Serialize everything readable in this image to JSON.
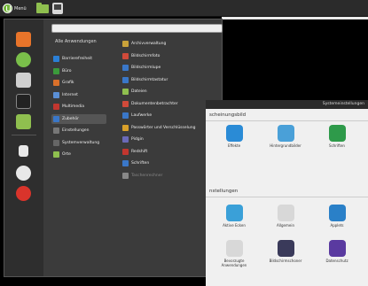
{
  "panel": {
    "menu_label": "Menü"
  },
  "menu": {
    "search_placeholder": "",
    "all_apps": "Alle Anwendungen",
    "categories": [
      {
        "label": "Barrierefreiheit",
        "color": "#2b7fd6",
        "icon": "accessibility-icon"
      },
      {
        "label": "Büro",
        "color": "#3b9a3b",
        "icon": "office-icon"
      },
      {
        "label": "Grafik",
        "color": "#d9702a",
        "icon": "graphics-icon"
      },
      {
        "label": "Internet",
        "color": "#5a8fd6",
        "icon": "internet-icon"
      },
      {
        "label": "Multimedia",
        "color": "#c2362f",
        "icon": "multimedia-icon"
      },
      {
        "label": "Zubehör",
        "color": "#3a77c8",
        "icon": "accessories-icon"
      },
      {
        "label": "Einstellungen",
        "color": "#777777",
        "icon": "settings-icon"
      },
      {
        "label": "Systemverwaltung",
        "color": "#666666",
        "icon": "administration-icon"
      },
      {
        "label": "Orte",
        "color": "#8fbf4f",
        "icon": "places-icon"
      }
    ],
    "apps": [
      {
        "label": "Archivverwaltung",
        "color": "#c9a23a",
        "icon": "archive-icon"
      },
      {
        "label": "Bildschirmfoto",
        "color": "#d04a3a",
        "icon": "screenshot-icon"
      },
      {
        "label": "Bildschirmlupe",
        "color": "#3a77c8",
        "icon": "magnifier-icon"
      },
      {
        "label": "Bildschirmtastatur",
        "color": "#3a77c8",
        "icon": "onscreen-keyboard-icon"
      },
      {
        "label": "Dateien",
        "color": "#8fbf4f",
        "icon": "files-icon"
      },
      {
        "label": "Dokumentenbetrachter",
        "color": "#d04a3a",
        "icon": "document-viewer-icon"
      },
      {
        "label": "Laufwerke",
        "color": "#3a77c8",
        "icon": "disks-icon"
      },
      {
        "label": "Passwörter und Verschlüsselung",
        "color": "#d9a02a",
        "icon": "passwords-icon"
      },
      {
        "label": "Pidgin",
        "color": "#6a6ab8",
        "icon": "pidgin-icon"
      },
      {
        "label": "Redshift",
        "color": "#c2362f",
        "icon": "redshift-icon"
      },
      {
        "label": "Schriften",
        "color": "#3a77c8",
        "icon": "fonts-icon"
      },
      {
        "label": "Taschenrechner",
        "color": "#888888",
        "icon": "calculator-icon"
      }
    ]
  },
  "settings": {
    "title": "Systemeinstellungen",
    "section1": "scheinungsbild",
    "section2": "nstellungen",
    "appearance": [
      {
        "label": "Effekte",
        "color": "#2a8bd6",
        "icon": "effects-icon"
      },
      {
        "label": "Hintergrundbilder",
        "color": "#4aa0d8",
        "icon": "backgrounds-icon"
      },
      {
        "label": "Schriften",
        "color": "#2e9a4a",
        "icon": "fonts-icon"
      }
    ],
    "prefs": [
      {
        "label": "Aktive Ecken",
        "color": "#3aa0d8",
        "icon": "hot-corners-icon"
      },
      {
        "label": "Allgemein",
        "color": "#d8d8d8",
        "icon": "general-icon"
      },
      {
        "label": "Applets",
        "color": "#2a80c8",
        "icon": "applets-icon"
      },
      {
        "label": "Bevorzugte Anwendungen",
        "color": "#d8d8d8",
        "icon": "preferred-apps-icon"
      },
      {
        "label": "Bildschirmschoner",
        "color": "#3a3a5a",
        "icon": "screensaver-icon"
      },
      {
        "label": "Datenschutz",
        "color": "#5a3aa0",
        "icon": "privacy-icon"
      }
    ]
  }
}
